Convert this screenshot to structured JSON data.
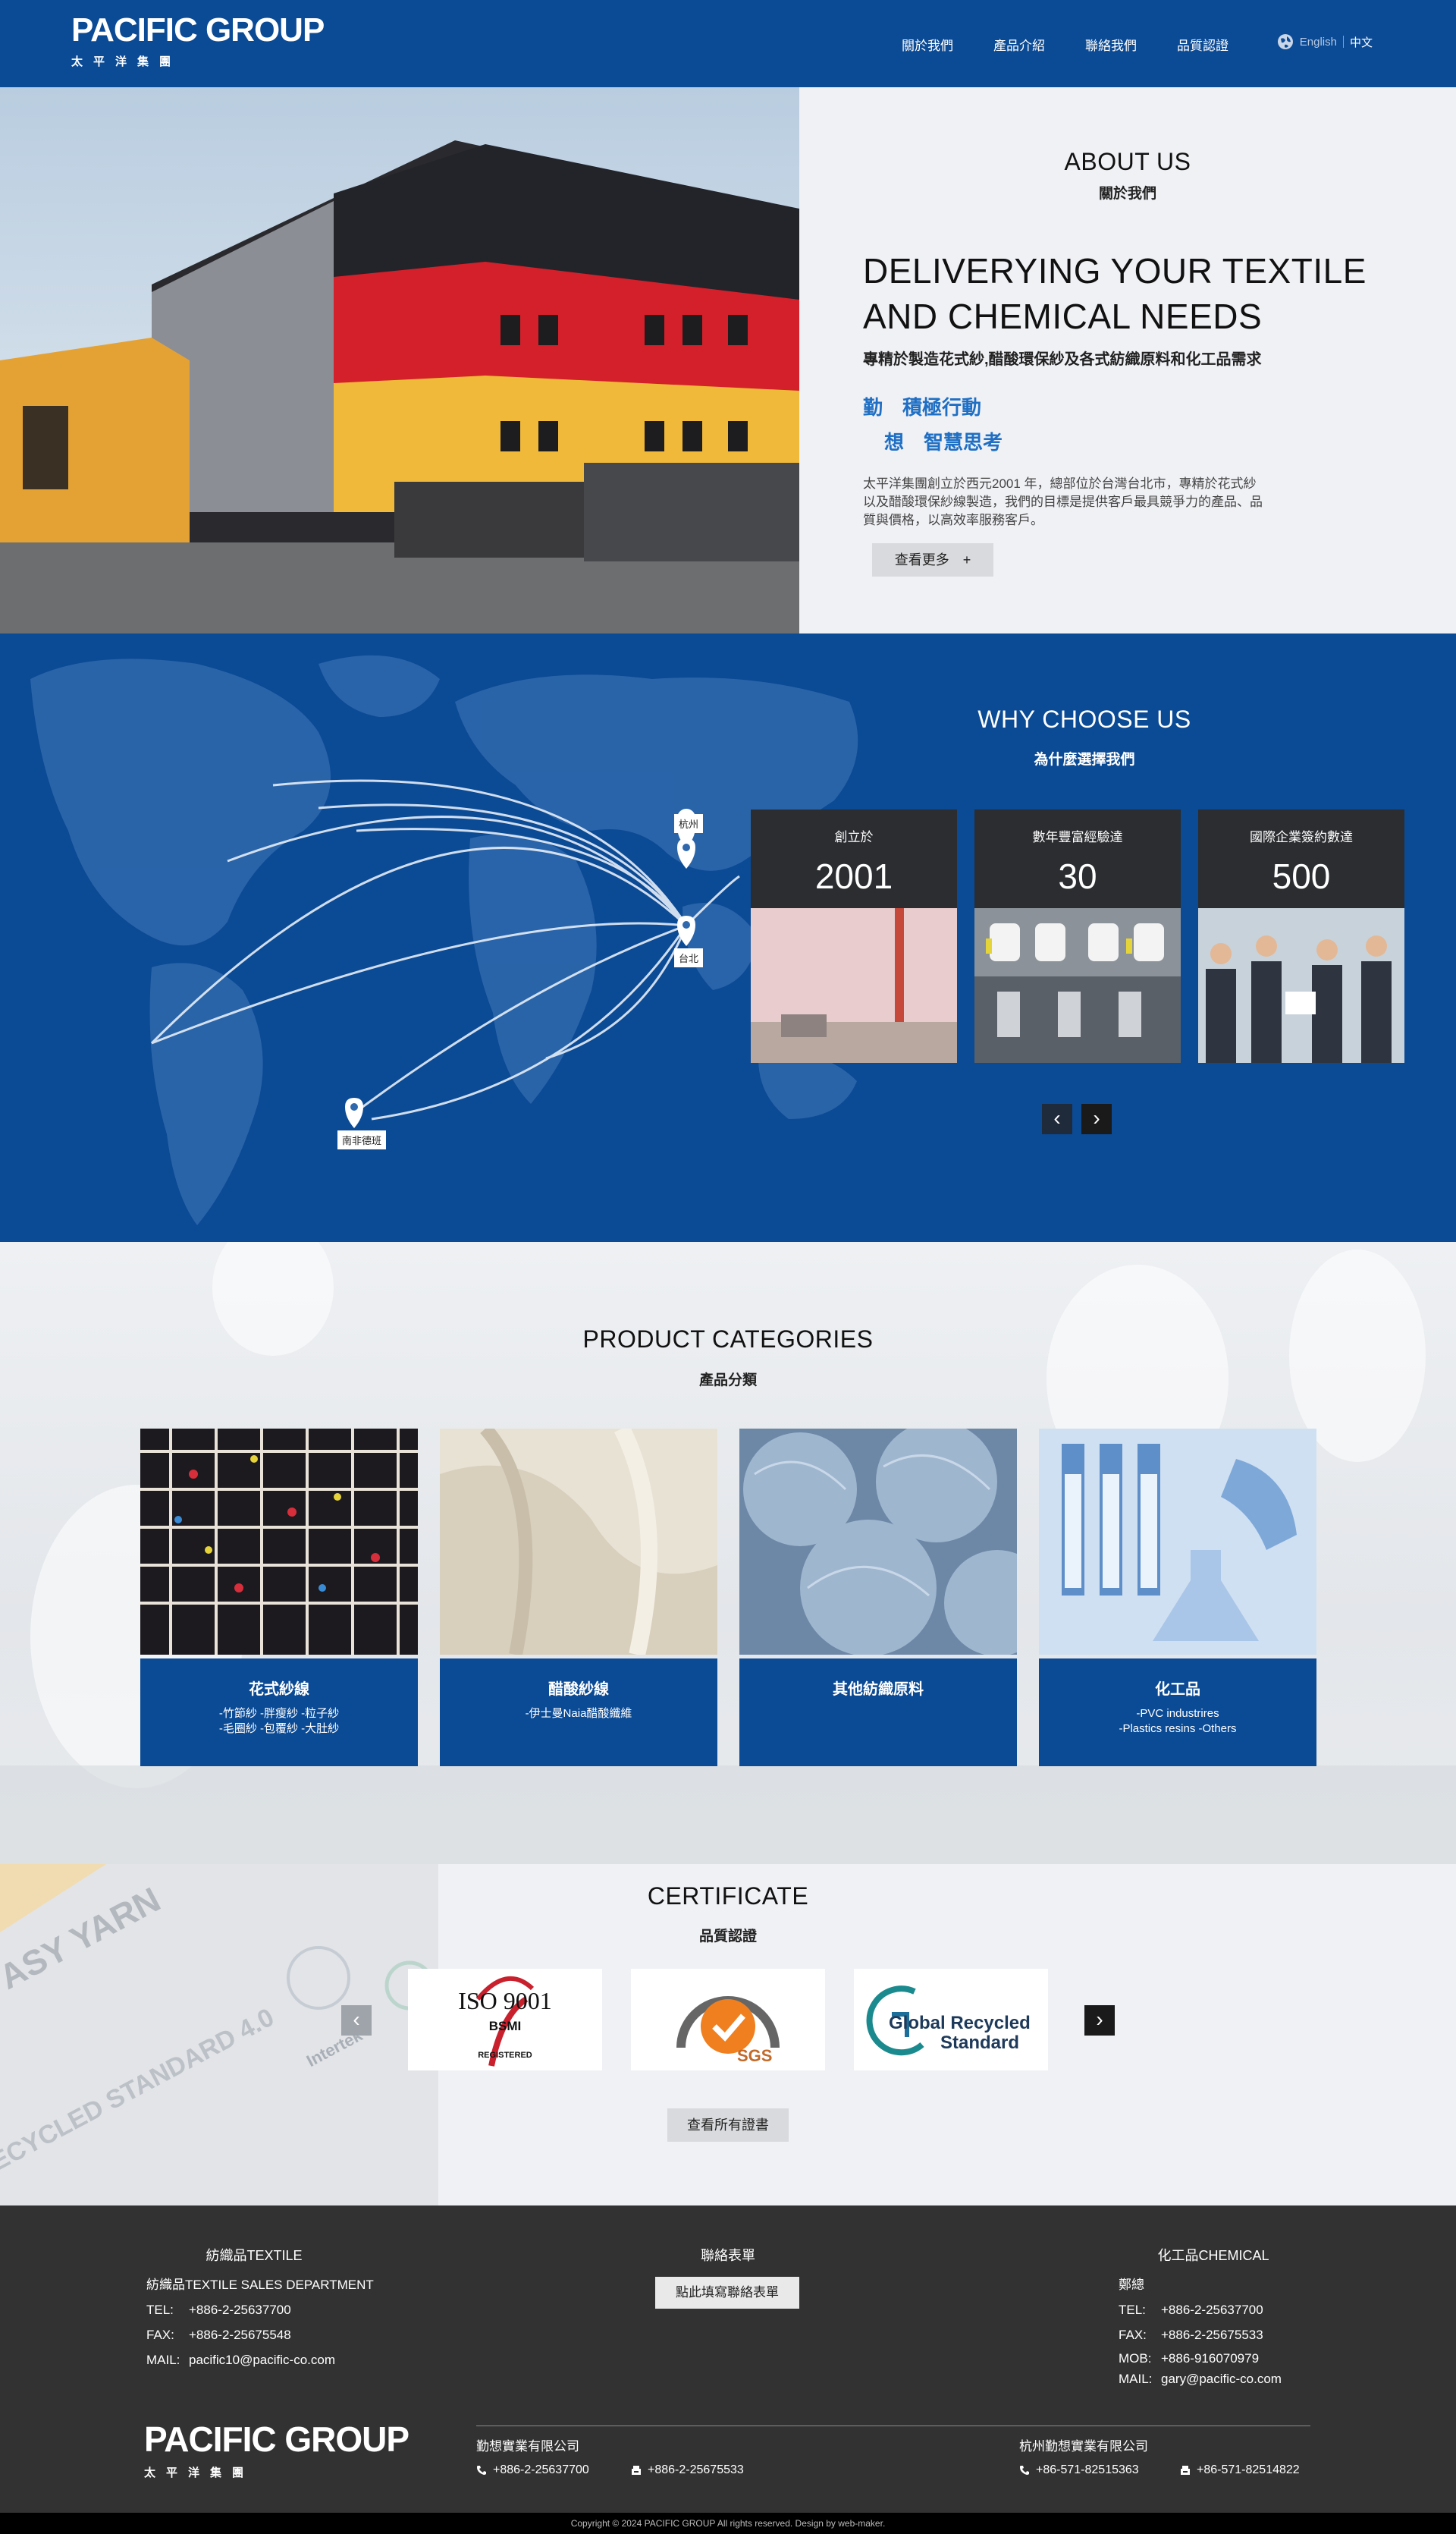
{
  "header": {
    "logo_en": "PACIFIC GROUP",
    "logo_cn": "太平洋集團",
    "nav": [
      "關於我們",
      "產品介紹",
      "聯絡我們",
      "品質認證"
    ],
    "lang_en": "English",
    "lang_cn": "中文"
  },
  "hero": {
    "title": "ABOUT US",
    "subtitle": "關於我們",
    "headline_1": "DELIVERYING YOUR TEXTILE",
    "headline_2": "AND CHEMICAL NEEDS",
    "tagline": "專精於製造花式紗,醋酸環保紗及各式紡織原料和化工品需求",
    "slogan_1": "勤　積極行動",
    "slogan_2": "想　智慧思考",
    "description": "太平洋集團創立於西元2001 年，總部位於台灣台北市，專精於花式紗以及醋酸環保紗線製造，我們的目標是提供客戶最具競爭力的產品、品質與價格，以高效率服務客戶。",
    "more_button": "查看更多　+",
    "slide_count": 2,
    "active_slide": 1
  },
  "why": {
    "title": "WHY CHOOSE US",
    "subtitle": "為什麼選擇我們",
    "pins": [
      "杭州",
      "台北",
      "南非德班"
    ],
    "stats": [
      {
        "label": "創立於",
        "value": "2001"
      },
      {
        "label": "數年豐富經驗達",
        "value": "30"
      },
      {
        "label": "國際企業簽約數達",
        "value": "500"
      }
    ],
    "prev": "‹",
    "next": "›"
  },
  "products": {
    "title": "PRODUCT CATEGORIES",
    "subtitle": "產品分類",
    "items": [
      {
        "name": "花式紗線",
        "desc1": "-竹節紗 -胖瘦紗 -粒子紗",
        "desc2": "-毛圈紗 -包覆紗 -大肚紗"
      },
      {
        "name": "醋酸紗線",
        "desc1": "-伊士曼Naia醋酸纖維",
        "desc2": ""
      },
      {
        "name": "其他紡織原料",
        "desc1": "",
        "desc2": ""
      },
      {
        "name": "化工品",
        "desc1": "-PVC industrires",
        "desc2": "-Plastics resins -Others"
      }
    ]
  },
  "certificate": {
    "title": "CERTIFICATE",
    "subtitle": "品質認證",
    "iso_text": "ISO 9001",
    "bsmi_text": "BSMI",
    "registered": "REGISTERED",
    "sgs_text": "SGS",
    "grs_line1": "Global Recycled",
    "grs_line2": "Standard",
    "bg_text_1": "ASY YARN",
    "bg_text_2": "RECYCLED STANDARD 4.0",
    "bg_text_3": "Intertek",
    "view_all": "查看所有證書",
    "prev": "‹",
    "next": "›"
  },
  "footer": {
    "textile_title": "紡織品TEXTILE",
    "textile_dept": "紡織品TEXTILE SALES DEPARTMENT",
    "textile_tel": "+886-2-25637700",
    "textile_fax": "+886-2-25675548",
    "textile_mail": "pacific10@pacific-co.com",
    "form_title": "聯絡表單",
    "form_button": "點此填寫聯絡表單",
    "chem_title": "化工品CHEMICAL",
    "chem_name": "鄭總",
    "chem_tel": "+886-2-25637700",
    "chem_fax": "+886-2-25675533",
    "chem_mob": "+886-916070979",
    "chem_mail": "gary@pacific-co.com",
    "k_tel": "TEL:",
    "k_fax": "FAX:",
    "k_mail": "MAIL:",
    "k_mob": "MOB:",
    "logo_en": "PACIFIC GROUP",
    "logo_cn": "太平洋集團",
    "company_1": "勤想實業有限公司",
    "company_1_phone": "+886-2-25637700",
    "company_1_fax": "+886-2-25675533",
    "company_2": "杭州勤想實業有限公司",
    "company_2_phone": "+86-571-82515363",
    "company_2_fax": "+86-571-82514822",
    "copyright": "Copyright © 2024 PACIFIC GROUP All rights reserved. Design by web-maker."
  }
}
